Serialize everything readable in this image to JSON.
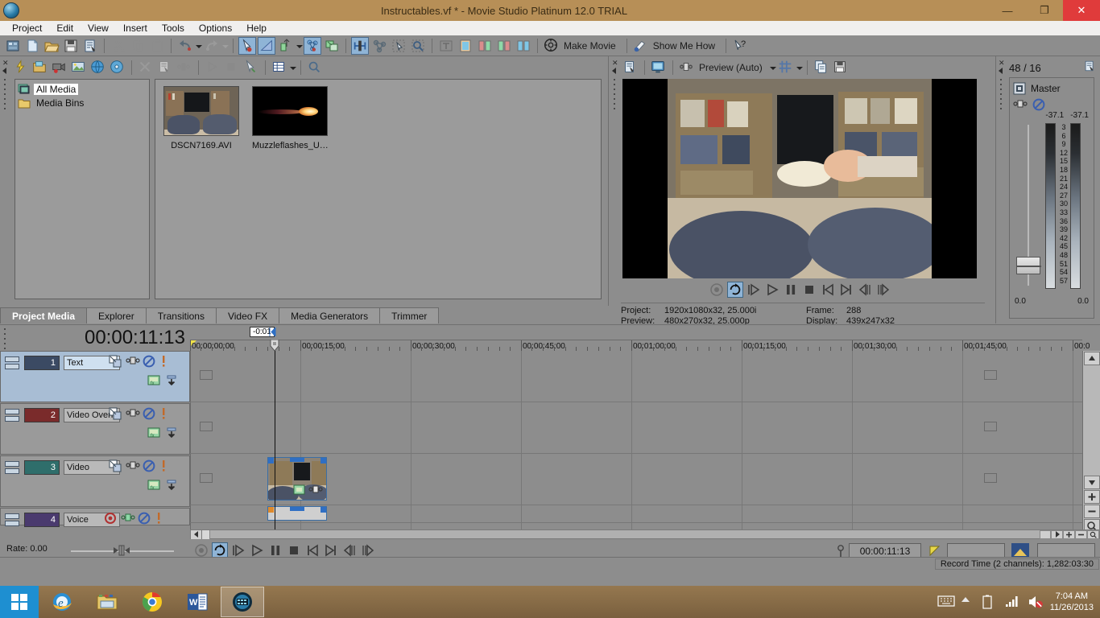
{
  "window": {
    "title": "Instructables.vf * - Movie Studio Platinum 12.0 TRIAL",
    "app_icon": "movie-studio-icon",
    "minimize": "—",
    "maximize": "❐",
    "close": "✕"
  },
  "menu": {
    "items": [
      "Project",
      "Edit",
      "View",
      "Insert",
      "Tools",
      "Options",
      "Help"
    ]
  },
  "toolbar": {
    "make_movie": "Make Movie",
    "show_me_how": "Show Me How",
    "icons": [
      "new-project-icon",
      "new-file-icon",
      "open-project-icon",
      "save-project-icon",
      "properties-icon",
      "cut-icon",
      "copy-icon",
      "paste-icon",
      "undo-icon",
      "redo-icon",
      "enable-snapping-icon",
      "auto-ripple-icon",
      "normal-edit-tool-icon",
      "envelope-edit-tool-icon",
      "selection-edit-tool-icon",
      "zoom-edit-tool-icon",
      "crossfade-icon",
      "automatic-crossfades-icon",
      "lock-envelopes-icon",
      "ignore-event-grouping-icon",
      "make-movie-icon",
      "show-me-how-icon",
      "whats-this-help-icon"
    ]
  },
  "media_panel": {
    "toolbar_icons": [
      "import-media-icon",
      "open-folder-icon",
      "capture-video-icon",
      "get-photo-icon",
      "get-media-from-web-icon",
      "extract-audio-cd-icon",
      "remove-icon",
      "properties-icon",
      "split-icon",
      "play-icon",
      "stop-icon",
      "select-icon",
      "views-icon",
      "views-dropdown-icon",
      "search-icon"
    ],
    "tree": [
      {
        "label": "All Media",
        "icon": "all-media-icon",
        "selected": true
      },
      {
        "label": "Media Bins",
        "icon": "media-bins-folder-icon",
        "selected": false
      }
    ],
    "thumbnails": [
      {
        "caption": "DSCN7169.AVI",
        "kind": "room-video-thumb"
      },
      {
        "caption": "Muzzleflashes_U…",
        "kind": "muzzle-flash-thumb"
      }
    ],
    "tabs": [
      {
        "label": "Project Media",
        "active": true
      },
      {
        "label": "Explorer",
        "active": false
      },
      {
        "label": "Transitions",
        "active": false
      },
      {
        "label": "Video FX",
        "active": false
      },
      {
        "label": "Media Generators",
        "active": false
      },
      {
        "label": "Trimmer",
        "active": false
      }
    ]
  },
  "preview": {
    "quality_label": "Preview (Auto)",
    "toolbar_icons": [
      "video-output-properties-icon",
      "display-mode-icon",
      "split-screen-icon",
      "preview-quality-dropdown-icon",
      "overlays-icon",
      "overlays-dropdown-icon",
      "copy-snapshot-icon",
      "save-snapshot-icon"
    ],
    "transport_icons": [
      "record-icon",
      "loop-playback-icon",
      "play-from-start-icon",
      "play-icon",
      "pause-icon",
      "stop-icon",
      "go-to-start-icon",
      "go-to-end-icon",
      "previous-frame-icon",
      "next-frame-icon"
    ],
    "status": {
      "project_label": "Project:",
      "project_value": "1920x1080x32, 25.000i",
      "preview_label": "Preview:",
      "preview_value": "480x270x32, 25.000p",
      "frame_label": "Frame:",
      "frame_value": "288",
      "display_label": "Display:",
      "display_value": "439x247x32"
    }
  },
  "mixer": {
    "header": "48 / 16",
    "header_icon": "mixer-properties-icon",
    "master_label": "Master",
    "master_icon": "master-bus-icon",
    "fader_icon": "fader-icon",
    "mute_icon": "mute-icon",
    "peak_left": "-37.1",
    "peak_right": "-37.1",
    "scale": [
      "3",
      "6",
      "9",
      "12",
      "15",
      "18",
      "21",
      "24",
      "27",
      "30",
      "33",
      "36",
      "39",
      "42",
      "45",
      "48",
      "51",
      "54",
      "57"
    ],
    "value_left": "0.0",
    "value_right": "0.0"
  },
  "timeline": {
    "timecode": "00:00:11:13",
    "cursor_tooltip": "-0:01",
    "ruler_labels": [
      "00:00:00:00",
      "00:00:15:00",
      "00:00:30:00",
      "00:00:45:00",
      "00:01:00:00",
      "00:01:15:00",
      "00:01:30:00",
      "00:01:45:00",
      "00:0"
    ],
    "tracks": [
      {
        "number": "1",
        "name": "Text",
        "selected": true,
        "color": "#3b4a63",
        "type": "video"
      },
      {
        "number": "2",
        "name": "Video Overlay",
        "selected": false,
        "color": "#7a2b2b",
        "type": "video"
      },
      {
        "number": "3",
        "name": "Video",
        "selected": false,
        "color": "#2f6e6b",
        "type": "video"
      },
      {
        "number": "4",
        "name": "Voice",
        "selected": false,
        "color": "#4a3a6e",
        "type": "audio"
      }
    ],
    "track_icons": {
      "minimize": "track-minimize-icon",
      "maximize": "track-maximize-icon",
      "compositing": "compositing-mode-icon",
      "fader": "track-fader-icon",
      "mute": "track-mute-icon",
      "solo": "track-solo-icon",
      "fx": "track-fx-icon",
      "automation": "automation-settings-icon",
      "arm": "arm-for-record-icon"
    },
    "transport_icons": [
      "record-icon",
      "loop-playback-icon",
      "play-from-start-icon",
      "play-icon",
      "pause-icon",
      "stop-icon",
      "go-to-start-icon",
      "go-to-end-icon",
      "previous-frame-icon",
      "next-frame-icon"
    ],
    "rate_label": "Rate: 0.00",
    "cursor_timecode": "00:00:11:13",
    "selection_start_icon": "selection-start-icon",
    "selection_length_icon": "selection-length-icon",
    "scroll_icons": [
      "scroll-left-icon",
      "scroll-right-icon",
      "zoom-in-icon",
      "zoom-out-icon",
      "zoom-tool-icon"
    ],
    "status": "Record Time (2 channels): 1,282:03:30"
  },
  "taskbar": {
    "start_label": "start-button",
    "items": [
      {
        "name": "internet-explorer",
        "active": false
      },
      {
        "name": "file-explorer",
        "active": false
      },
      {
        "name": "google-chrome",
        "active": false
      },
      {
        "name": "microsoft-word",
        "active": false
      },
      {
        "name": "movie-studio-platinum",
        "active": true
      }
    ],
    "tray_icons": [
      "keyboard-icon",
      "show-hidden-icons-icon",
      "battery-icon",
      "network-signal-icon",
      "volume-muted-icon"
    ],
    "time": "7:04 AM",
    "date": "11/26/2013"
  }
}
